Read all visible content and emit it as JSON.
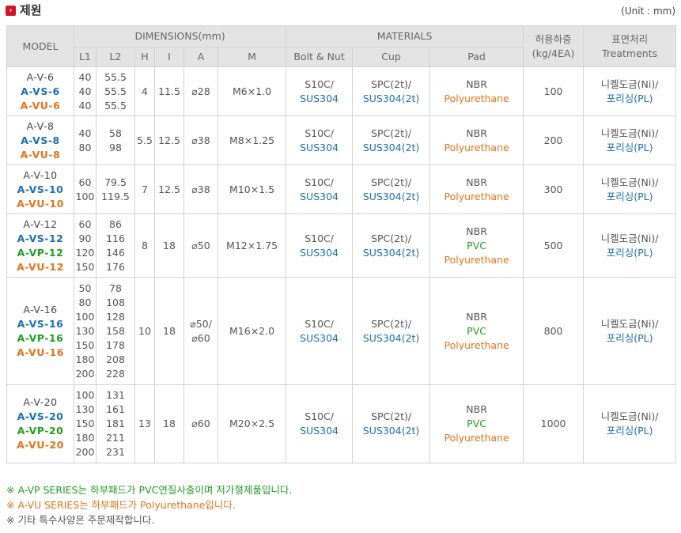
{
  "title": {
    "icon": "arrow-right-icon",
    "text": "제원",
    "unit": "(Unit : mm)"
  },
  "header": {
    "model": "MODEL",
    "dimensions": "DIMENSIONS(mm)",
    "materials": "MATERIALS",
    "load": "허용하중 (kg/4EA)",
    "treat_ko": "표면처리",
    "treat_en": "Treatments",
    "dims": [
      "L1",
      "L2",
      "H",
      "I",
      "A",
      "M"
    ],
    "mats": [
      "Bolt & Nut",
      "Cup",
      "Pad"
    ]
  },
  "rows": [
    {
      "models": [
        "A-V-6",
        "A-VS-6",
        "A-VU-6"
      ],
      "l1": [
        "40",
        "40",
        "40"
      ],
      "l2": [
        "55.5",
        "55.5",
        "55.5"
      ],
      "h": "4",
      "i": "11.5",
      "a": [
        "⌀28"
      ],
      "m": "M6×1.0",
      "bolt": [
        "S10C/",
        "SUS304"
      ],
      "cup": [
        "SPC(2t)/",
        "SUS304(2t)"
      ],
      "pad": [
        "NBR",
        "Polyurethane"
      ],
      "load": "100",
      "treat": [
        "니켈도금(Ni)/",
        "포리싱(PL)"
      ]
    },
    {
      "models": [
        "A-V-8",
        "A-VS-8",
        "A-VU-8"
      ],
      "l1": [
        "40",
        "80"
      ],
      "l2": [
        "58",
        "98"
      ],
      "h": "5.5",
      "i": "12.5",
      "a": [
        "⌀38"
      ],
      "m": "M8×1.25",
      "bolt": [
        "S10C/",
        "SUS304"
      ],
      "cup": [
        "SPC(2t)/",
        "SUS304(2t)"
      ],
      "pad": [
        "NBR",
        "Polyurethane"
      ],
      "load": "200",
      "treat": [
        "니켈도금(Ni)/",
        "포리싱(PL)"
      ]
    },
    {
      "models": [
        "A-V-10",
        "A-VS-10",
        "A-VU-10"
      ],
      "l1": [
        "60",
        "100"
      ],
      "l2": [
        "79.5",
        "119.5"
      ],
      "h": "7",
      "i": "12.5",
      "a": [
        "⌀38"
      ],
      "m": "M10×1.5",
      "bolt": [
        "S10C/",
        "SUS304"
      ],
      "cup": [
        "SPC(2t)/",
        "SUS304(2t)"
      ],
      "pad": [
        "NBR",
        "Polyurethane"
      ],
      "load": "300",
      "treat": [
        "니켈도금(Ni)/",
        "포리싱(PL)"
      ]
    },
    {
      "models": [
        "A-V-12",
        "A-VS-12",
        "A-VP-12",
        "A-VU-12"
      ],
      "l1": [
        "60",
        "90",
        "120",
        "150"
      ],
      "l2": [
        "86",
        "116",
        "146",
        "176"
      ],
      "h": "8",
      "i": "18",
      "a": [
        "⌀50"
      ],
      "m": "M12×1.75",
      "bolt": [
        "S10C/",
        "SUS304"
      ],
      "cup": [
        "SPC(2t)/",
        "SUS304(2t)"
      ],
      "pad": [
        "NBR",
        "PVC",
        "Polyurethane"
      ],
      "load": "500",
      "treat": [
        "니켈도금(Ni)/",
        "포리싱(PL)"
      ]
    },
    {
      "models": [
        "A-V-16",
        "A-VS-16",
        "A-VP-16",
        "A-VU-16"
      ],
      "l1": [
        "50",
        "80",
        "100",
        "130",
        "150",
        "180",
        "200"
      ],
      "l2": [
        "78",
        "108",
        "128",
        "158",
        "178",
        "208",
        "228"
      ],
      "h": "10",
      "i": "18",
      "a": [
        "⌀50/",
        "⌀60"
      ],
      "m": "M16×2.0",
      "bolt": [
        "S10C/",
        "SUS304"
      ],
      "cup": [
        "SPC(2t)/",
        "SUS304(2t)"
      ],
      "pad": [
        "NBR",
        "PVC",
        "Polyurethane"
      ],
      "load": "800",
      "treat": [
        "니켈도금(Ni)/",
        "포리싱(PL)"
      ]
    },
    {
      "models": [
        "A-V-20",
        "A-VS-20",
        "A-VP-20",
        "A-VU-20"
      ],
      "l1": [
        "100",
        "130",
        "150",
        "180",
        "200"
      ],
      "l2": [
        "131",
        "161",
        "181",
        "211",
        "231"
      ],
      "h": "13",
      "i": "18",
      "a": [
        "⌀60"
      ],
      "m": "M20×2.5",
      "bolt": [
        "S10C/",
        "SUS304"
      ],
      "cup": [
        "SPC(2t)/",
        "SUS304(2t)"
      ],
      "pad": [
        "NBR",
        "PVC",
        "Polyurethane"
      ],
      "load": "1000",
      "treat": [
        "니켈도금(Ni)/",
        "포리싱(PL)"
      ]
    }
  ],
  "notes": [
    {
      "text": "※ A-VP SERIES는 하부패드가 PVC연질사출이며 저가형제품입니다.",
      "color": "#1f9e22"
    },
    {
      "text": "※ A-VU SERIES는 하부패드가 Polyurethane입니다.",
      "color": "#e3731b"
    },
    {
      "text": "※ 기타 특수사양은 주문제작합니다.",
      "color": "#555555"
    }
  ],
  "colors": {
    "blue": "#1b6eb4",
    "green": "#1f9e22",
    "orange": "#e3731b",
    "header_bg": "#e3e3e3",
    "title_icon": "#d4112b"
  }
}
